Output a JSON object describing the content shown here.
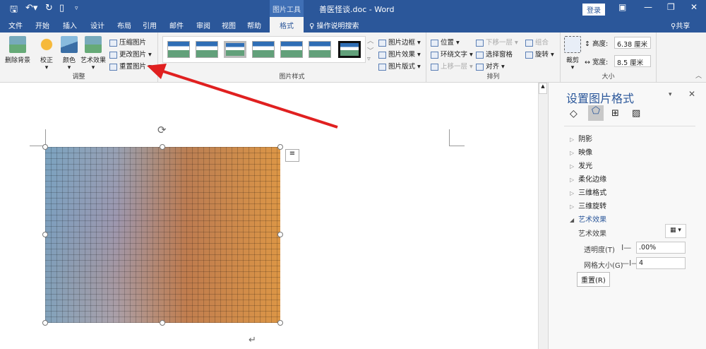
{
  "title": {
    "context_tab": "图片工具",
    "document": "善医怪谈.doc  -  Word",
    "login": "登录"
  },
  "tabs": [
    "文件",
    "开始",
    "插入",
    "设计",
    "布局",
    "引用",
    "邮件",
    "审阅",
    "视图",
    "帮助",
    "格式"
  ],
  "tell_me": "操作说明搜索",
  "share": "共享",
  "ribbon": {
    "adjust": {
      "label": "调整",
      "remove_bg": "删除背景",
      "correct": "校正",
      "color": "颜色",
      "artistic": "艺术效果",
      "compress": "压缩图片",
      "change": "更改图片",
      "reset": "重置图片"
    },
    "styles": {
      "label": "图片样式",
      "border": "图片边框",
      "effects": "图片效果",
      "layout": "图片版式"
    },
    "arrange": {
      "label": "排列",
      "position": "位置",
      "wrap": "环绕文字",
      "forward": "上移一层",
      "backward": "下移一层",
      "selection": "选择窗格",
      "align": "对齐",
      "group": "组合",
      "rotate": "旋转"
    },
    "size": {
      "label": "大小",
      "crop": "裁剪",
      "height_label": "高度:",
      "height": "6.38 厘米",
      "width_label": "宽度:",
      "width": "8.5 厘米"
    }
  },
  "pane": {
    "title": "设置图片格式",
    "items": [
      "阴影",
      "映像",
      "发光",
      "柔化边缘",
      "三维格式",
      "三维旋转"
    ],
    "expanded": "艺术效果",
    "effect_label": "艺术效果",
    "transparency_label": "透明度(T)",
    "transparency": ".00%",
    "grid_label": "网格大小(G)",
    "grid": "4",
    "reset": "重置(R)"
  },
  "colors": {
    "accent": "#2b579a",
    "arrow": "#e02020"
  }
}
